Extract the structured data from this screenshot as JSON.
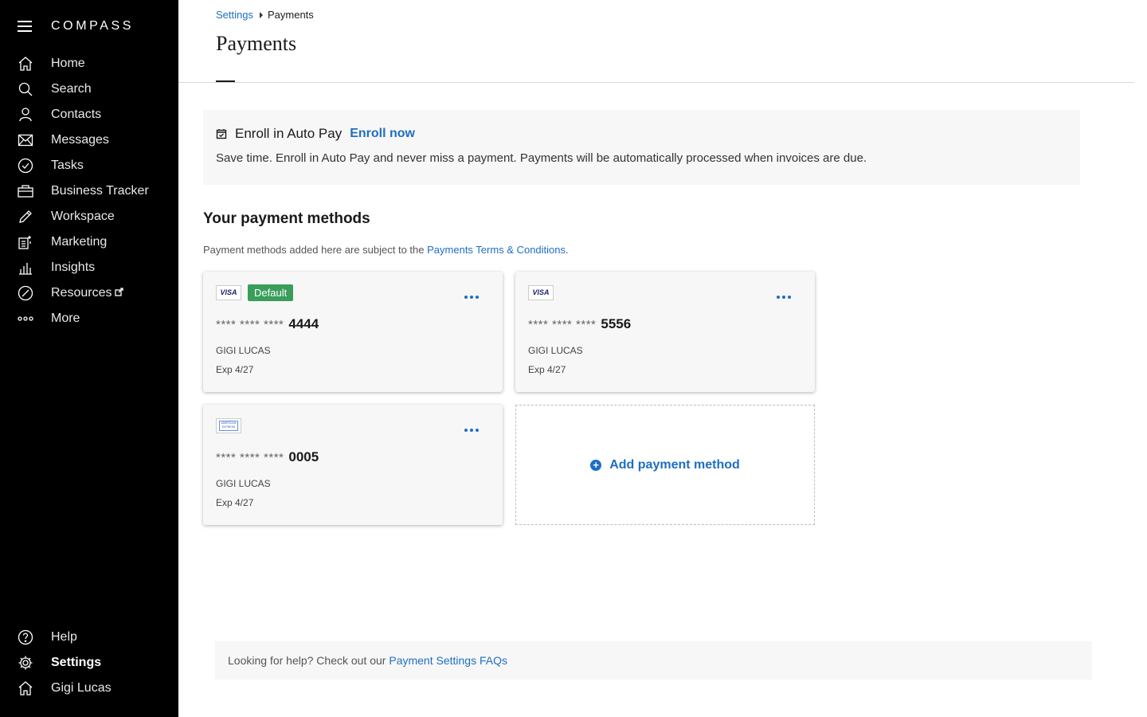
{
  "app": {
    "logo": "COMPASS"
  },
  "sidebar": {
    "items": [
      {
        "label": "Home",
        "icon": "home-icon"
      },
      {
        "label": "Search",
        "icon": "search-icon"
      },
      {
        "label": "Contacts",
        "icon": "contacts-icon"
      },
      {
        "label": "Messages",
        "icon": "mail-icon"
      },
      {
        "label": "Tasks",
        "icon": "check-circle-icon"
      },
      {
        "label": "Business Tracker",
        "icon": "briefcase-icon"
      },
      {
        "label": "Workspace",
        "icon": "pencil-icon"
      },
      {
        "label": "Marketing",
        "icon": "marketing-icon"
      },
      {
        "label": "Insights",
        "icon": "bar-chart-icon"
      },
      {
        "label": "Resources",
        "icon": "compass-icon"
      },
      {
        "label": "More",
        "icon": "more-icon"
      }
    ],
    "bottom": [
      {
        "label": "Help",
        "icon": "help-icon"
      },
      {
        "label": "Settings",
        "icon": "gear-icon"
      },
      {
        "label": "Gigi Lucas",
        "icon": "home-icon"
      }
    ]
  },
  "breadcrumb": {
    "parent": "Settings",
    "current": "Payments"
  },
  "page": {
    "title": "Payments"
  },
  "autopay": {
    "title": "Enroll in Auto Pay",
    "link": "Enroll now",
    "description": "Save time. Enroll in Auto Pay and never miss a payment. Payments will be automatically processed when invoices are due."
  },
  "payment_methods": {
    "title": "Your payment methods",
    "subtitle_prefix": "Payment methods added here are subject to the ",
    "subtitle_link": "Payments Terms & Conditions",
    "subtitle_suffix": ".",
    "cards": [
      {
        "brand": "VISA",
        "default_label": "Default",
        "mask": "**** **** ****",
        "last4": "4444",
        "name": "GIGI LUCAS",
        "exp": "Exp 4/27"
      },
      {
        "brand": "VISA",
        "mask": "**** **** ****",
        "last4": "5556",
        "name": "GIGI LUCAS",
        "exp": "Exp 4/27"
      },
      {
        "brand": "AMERICAN EXPRESS",
        "mask": "**** **** ****",
        "last4": "0005",
        "name": "GIGI LUCAS",
        "exp": "Exp 4/27"
      }
    ],
    "add_label": "Add payment method"
  },
  "help": {
    "prefix": "Looking for help? Check out our ",
    "link": "Payment Settings FAQs"
  },
  "colors": {
    "accent": "#1f6ec2",
    "default_badge": "#3a9d5a",
    "sidebar_bg": "#000000"
  }
}
